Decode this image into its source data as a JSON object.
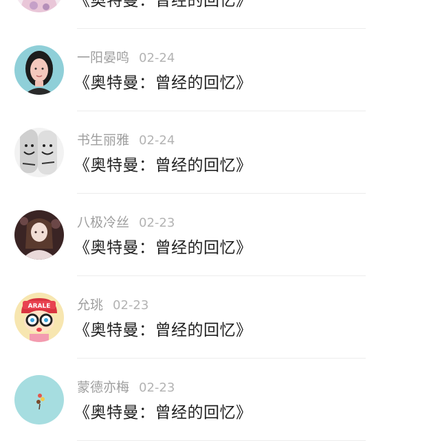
{
  "comments": [
    {
      "name": "",
      "date": "",
      "text": "《奥特曼：曾经的回忆》",
      "avatar": "anime-girl-pink-avatar"
    },
    {
      "name": "一阳晏鸣",
      "date": "02-24",
      "text": "《奥特曼：曾经的回忆》",
      "avatar": "woman-photo-avatar"
    },
    {
      "name": "书生丽雅",
      "date": "02-24",
      "text": "《奥特曼：曾经的回忆》",
      "avatar": "drawn-faces-fingers-avatar"
    },
    {
      "name": "八极冷丝",
      "date": "02-23",
      "text": "《奥特曼：曾经的回忆》",
      "avatar": "anime-girl-dark-avatar"
    },
    {
      "name": "允珧",
      "date": "02-23",
      "text": "《奥特曼：曾经的回忆》",
      "avatar": "arale-cartoon-avatar"
    },
    {
      "name": "蒙德亦梅",
      "date": "02-23",
      "text": "《奥特曼：曾经的回忆》",
      "avatar": "candy-on-teal-avatar"
    }
  ]
}
